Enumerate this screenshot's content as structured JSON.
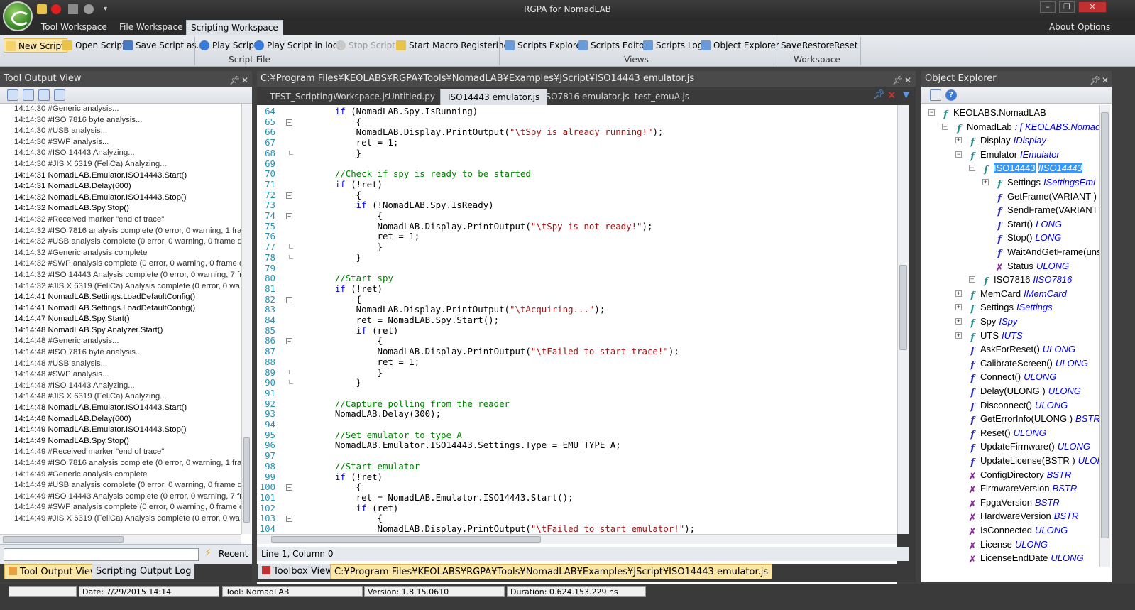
{
  "window": {
    "title": "RGPA for NomadLAB",
    "tabs": [
      "Tool Workspace",
      "File Workspace",
      "Scripting Workspace"
    ],
    "about": "About",
    "options": "Options"
  },
  "ribbon": {
    "script_file": {
      "new_script": "New Script",
      "open_script": "Open Script",
      "save_script_as": "Save Script as...",
      "play_script": "Play Script",
      "play_script_loop": "Play Script in loop",
      "stop_script": "Stop Script",
      "start_macro": "Start Macro Registering",
      "label": "Script File"
    },
    "views": {
      "scripts_explorer": "Scripts Explorer",
      "scripts_editor": "Scripts Editor",
      "scripts_log": "Scripts Log",
      "object_explorer": "Object Explorer",
      "label": "Views"
    },
    "workspace": {
      "save": "Save",
      "restore": "Restore",
      "reset": "Reset",
      "label": "Workspace"
    }
  },
  "tool_output": {
    "title": "Tool Output View",
    "lines": [
      "14:14:30 #Generic analysis...",
      "14:14:30 #ISO 7816 byte analysis...",
      "14:14:30 #USB analysis...",
      "14:14:30 #SWP analysis...",
      "14:14:30 #ISO 14443 Analyzing...",
      "14:14:30 #JIS X 6319 (FeliCa) Analyzing...",
      "14:14:31 NomadLAB.Emulator.ISO14443.Start()",
      "14:14:31 NomadLAB.Delay(600)",
      "14:14:32 NomadLAB.Emulator.ISO14443.Stop()",
      "14:14:32 NomadLAB.Spy.Stop()",
      "14:14:32 #Received marker \"end of trace\"",
      "14:14:32 #ISO 7816 analysis complete (0 error, 0 warning, 1 fran",
      "14:14:32 #USB analysis complete (0 error, 0 warning, 0 frame d",
      "14:14:32 #Generic analysis complete",
      "14:14:32 #SWP analysis complete (0 error, 0 warning, 0 frame d",
      "14:14:32 #ISO 14443 Analysis complete (0 error, 0 warning, 7 fr",
      "14:14:32 #JIS X 6319 (FeliCa) Analysis complete (0 error, 0 wa",
      "14:14:41 NomadLAB.Settings.LoadDefaultConfig()",
      "14:14:41 NomadLAB.Settings.LoadDefaultConfig()",
      "14:14:47 NomadLAB.Spy.Start()",
      "14:14:48 NomadLAB.Spy.Analyzer.Start()",
      "14:14:48 #Generic analysis...",
      "14:14:48 #ISO 7816 byte analysis...",
      "14:14:48 #USB analysis...",
      "14:14:48 #SWP analysis...",
      "14:14:48 #ISO 14443 Analyzing...",
      "14:14:48 #JIS X 6319 (FeliCa) Analyzing...",
      "14:14:48 NomadLAB.Emulator.ISO14443.Start()",
      "14:14:48 NomadLAB.Delay(600)",
      "14:14:49 NomadLAB.Emulator.ISO14443.Stop()",
      "14:14:49 NomadLAB.Spy.Stop()",
      "14:14:49 #Received marker \"end of trace\"",
      "14:14:49 #ISO 7816 analysis complete (0 error, 0 warning, 1 fran",
      "14:14:49 #Generic analysis complete",
      "14:14:49 #USB analysis complete (0 error, 0 warning, 0 frame d",
      "14:14:49 #ISO 14443 Analysis complete (0 error, 0 warning, 7 fr",
      "14:14:49 #SWP analysis complete (0 error, 0 warning, 0 frame d",
      "14:14:49 #JIS X 6319 (FeliCa) Analysis complete (0 error, 0 wa"
    ],
    "recent": "Recent",
    "bottom_tabs": [
      "Tool Output View",
      "Scripting Output Log"
    ]
  },
  "editor": {
    "path": "C:¥Program Files¥KEOLABS¥RGPA¥Tools¥NomadLAB¥Examples¥JScript¥ISO14443 emulator.js",
    "tabs": [
      "TEST_ScriptingWorkspace.js",
      "Untitled.py",
      "ISO14443 emulator.js",
      "ISO7816 emulator.js",
      "test_emuA.js"
    ],
    "status": "Line 1, Column 0",
    "bottom_tab": "Toolbox View",
    "bottom_path": "C:¥Program Files¥KEOLABS¥RGPA¥Tools¥NomadLAB¥Examples¥JScript¥ISO14443 emulator.js",
    "lines": [
      {
        "n": "64",
        "t": "    if (NomadLAB.Spy.IsRunning)"
      },
      {
        "n": "65",
        "t": "        {"
      },
      {
        "n": "66",
        "t": "        NomadLAB.Display.PrintOutput(\"\\tSpy is already running!\");"
      },
      {
        "n": "67",
        "t": "        ret = 1;"
      },
      {
        "n": "68",
        "t": "        }"
      },
      {
        "n": "69",
        "t": ""
      },
      {
        "n": "70",
        "t": "    //Check if spy is ready to be started"
      },
      {
        "n": "71",
        "t": "    if (!ret)"
      },
      {
        "n": "72",
        "t": "        {"
      },
      {
        "n": "73",
        "t": "        if (!NomadLAB.Spy.IsReady)"
      },
      {
        "n": "74",
        "t": "            {"
      },
      {
        "n": "75",
        "t": "            NomadLAB.Display.PrintOutput(\"\\tSpy is not ready!\");"
      },
      {
        "n": "76",
        "t": "            ret = 1;"
      },
      {
        "n": "77",
        "t": "            }"
      },
      {
        "n": "78",
        "t": "        }"
      },
      {
        "n": "79",
        "t": ""
      },
      {
        "n": "80",
        "t": "    //Start spy"
      },
      {
        "n": "81",
        "t": "    if (!ret)"
      },
      {
        "n": "82",
        "t": "        {"
      },
      {
        "n": "83",
        "t": "        NomadLAB.Display.PrintOutput(\"\\tAcquiring...\");"
      },
      {
        "n": "84",
        "t": "        ret = NomadLAB.Spy.Start();"
      },
      {
        "n": "85",
        "t": "        if (ret)"
      },
      {
        "n": "86",
        "t": "            {"
      },
      {
        "n": "87",
        "t": "            NomadLAB.Display.PrintOutput(\"\\tFailed to start trace!\");"
      },
      {
        "n": "88",
        "t": "            ret = 1;"
      },
      {
        "n": "89",
        "t": "            }"
      },
      {
        "n": "90",
        "t": "        }"
      },
      {
        "n": "91",
        "t": ""
      },
      {
        "n": "92",
        "t": "    //Capture polling from the reader"
      },
      {
        "n": "93",
        "t": "    NomadLAB.Delay(300);"
      },
      {
        "n": "94",
        "t": ""
      },
      {
        "n": "95",
        "t": "    //Set emulator to type A"
      },
      {
        "n": "96",
        "t": "    NomadLAB.Emulator.ISO14443.Settings.Type = EMU_TYPE_A;"
      },
      {
        "n": "97",
        "t": ""
      },
      {
        "n": "98",
        "t": "    //Start emulator"
      },
      {
        "n": "99",
        "t": "    if (!ret)"
      },
      {
        "n": "100",
        "t": "        {"
      },
      {
        "n": "101",
        "t": "        ret = NomadLAB.Emulator.ISO14443.Start();"
      },
      {
        "n": "102",
        "t": "        if (ret)"
      },
      {
        "n": "103",
        "t": "            {"
      },
      {
        "n": "104",
        "t": "            NomadLAB.Display.PrintOutput(\"\\tFailed to start emulator!\");"
      }
    ]
  },
  "object_explorer": {
    "title": "Object Explorer",
    "nodes": [
      {
        "name": "KEOLABS.NomadLAB",
        "type": "",
        "icon": "prop",
        "indent": 0,
        "exp": "-"
      },
      {
        "name": "NomadLab",
        "type": ": [ KEOLABS.Nomad",
        "icon": "prop",
        "indent": 1,
        "exp": "-"
      },
      {
        "name": "Display",
        "type": "IDisplay",
        "icon": "prop",
        "indent": 2,
        "exp": "+"
      },
      {
        "name": "Emulator",
        "type": "IEmulator",
        "icon": "prop",
        "indent": 2,
        "exp": "-"
      },
      {
        "name": "ISO14443",
        "type": "IISO14443",
        "icon": "prop",
        "indent": 3,
        "exp": "-",
        "selected": true
      },
      {
        "name": "Settings",
        "type": "ISettingsEmi",
        "icon": "prop",
        "indent": 4,
        "exp": "+"
      },
      {
        "name": "GetFrame(VARIANT )",
        "type": "",
        "icon": "meth",
        "indent": 4,
        "exp": ""
      },
      {
        "name": "SendFrame(VARIANT",
        "type": "",
        "icon": "meth",
        "indent": 4,
        "exp": ""
      },
      {
        "name": "Start()",
        "type": "LONG",
        "icon": "meth",
        "indent": 4,
        "exp": ""
      },
      {
        "name": "Stop()",
        "type": "LONG",
        "icon": "meth",
        "indent": 4,
        "exp": ""
      },
      {
        "name": "WaitAndGetFrame(uns",
        "type": "",
        "icon": "meth",
        "indent": 4,
        "exp": ""
      },
      {
        "name": "Status",
        "type": "ULONG",
        "icon": "x",
        "indent": 4,
        "exp": ""
      },
      {
        "name": "ISO7816",
        "type": "IISO7816",
        "icon": "prop",
        "indent": 3,
        "exp": "+"
      },
      {
        "name": "MemCard",
        "type": "IMemCard",
        "icon": "prop",
        "indent": 2,
        "exp": "+"
      },
      {
        "name": "Settings",
        "type": "ISettings",
        "icon": "prop",
        "indent": 2,
        "exp": "+"
      },
      {
        "name": "Spy",
        "type": "ISpy",
        "icon": "prop",
        "indent": 2,
        "exp": "+"
      },
      {
        "name": "UTS",
        "type": "IUTS",
        "icon": "prop",
        "indent": 2,
        "exp": "+"
      },
      {
        "name": "AskForReset()",
        "type": "ULONG",
        "icon": "meth",
        "indent": 2,
        "exp": ""
      },
      {
        "name": "CalibrateScreen()",
        "type": "ULONG",
        "icon": "meth",
        "indent": 2,
        "exp": ""
      },
      {
        "name": "Connect()",
        "type": "ULONG",
        "icon": "meth",
        "indent": 2,
        "exp": ""
      },
      {
        "name": "Delay(ULONG )",
        "type": "ULONG",
        "icon": "meth",
        "indent": 2,
        "exp": ""
      },
      {
        "name": "Disconnect()",
        "type": "ULONG",
        "icon": "meth",
        "indent": 2,
        "exp": ""
      },
      {
        "name": "GetErrorInfo(ULONG )",
        "type": "BSTR",
        "icon": "meth",
        "indent": 2,
        "exp": ""
      },
      {
        "name": "Reset()",
        "type": "ULONG",
        "icon": "meth",
        "indent": 2,
        "exp": ""
      },
      {
        "name": "UpdateFirmware()",
        "type": "ULONG",
        "icon": "meth",
        "indent": 2,
        "exp": ""
      },
      {
        "name": "UpdateLicense(BSTR )",
        "type": "ULOI",
        "icon": "meth",
        "indent": 2,
        "exp": ""
      },
      {
        "name": "ConfigDirectory",
        "type": "BSTR",
        "icon": "x",
        "indent": 2,
        "exp": ""
      },
      {
        "name": "FirmwareVersion",
        "type": "BSTR",
        "icon": "x",
        "indent": 2,
        "exp": ""
      },
      {
        "name": "FpgaVersion",
        "type": "BSTR",
        "icon": "x",
        "indent": 2,
        "exp": ""
      },
      {
        "name": "HardwareVersion",
        "type": "BSTR",
        "icon": "x",
        "indent": 2,
        "exp": ""
      },
      {
        "name": "IsConnected",
        "type": "ULONG",
        "icon": "x",
        "indent": 2,
        "exp": ""
      },
      {
        "name": "License",
        "type": "ULONG",
        "icon": "x",
        "indent": 2,
        "exp": ""
      },
      {
        "name": "LicenseEndDate",
        "type": "ULONG",
        "icon": "x",
        "indent": 2,
        "exp": ""
      }
    ]
  },
  "statusbar": {
    "date": "Date: 7/29/2015 14:14",
    "tool": "Tool: NomadLAB",
    "version": "Version: 1.8.15.0610",
    "duration": "Duration: 0.624.153.229 ns"
  },
  "colors": {
    "keyword": "#0000ff",
    "string": "#a31515",
    "comment": "#008000",
    "line_number": "#2b91af",
    "selection": "#3399ff"
  }
}
